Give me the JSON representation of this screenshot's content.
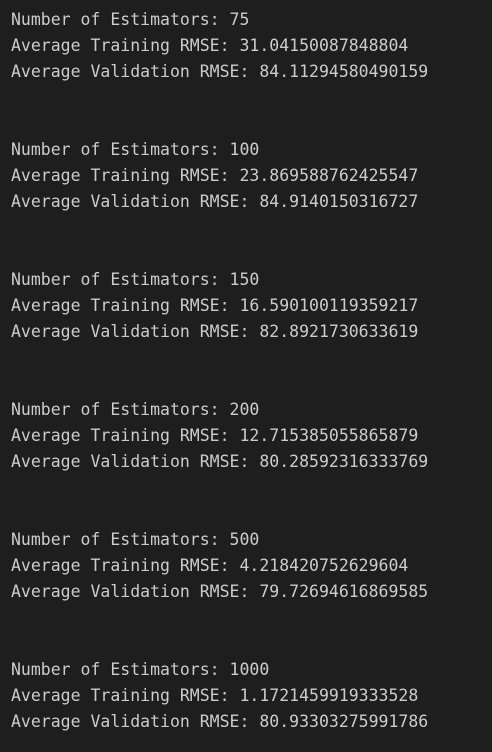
{
  "output": {
    "blocks": [
      {
        "estimators": "Number of Estimators: 75",
        "train": "Average Training RMSE: 31.04150087848804",
        "valid": "Average Validation RMSE: 84.11294580490159"
      },
      {
        "estimators": "Number of Estimators: 100",
        "train": "Average Training RMSE: 23.869588762425547",
        "valid": "Average Validation RMSE: 84.9140150316727"
      },
      {
        "estimators": "Number of Estimators: 150",
        "train": "Average Training RMSE: 16.590100119359217",
        "valid": "Average Validation RMSE: 82.8921730633619"
      },
      {
        "estimators": "Number of Estimators: 200",
        "train": "Average Training RMSE: 12.715385055865879",
        "valid": "Average Validation RMSE: 80.28592316333769"
      },
      {
        "estimators": "Number of Estimators: 500",
        "train": "Average Training RMSE: 4.218420752629604",
        "valid": "Average Validation RMSE: 79.72694616869585"
      },
      {
        "estimators": "Number of Estimators: 1000",
        "train": "Average Training RMSE: 1.1721459919333528",
        "valid": "Average Validation RMSE: 80.93303275991786"
      }
    ]
  }
}
